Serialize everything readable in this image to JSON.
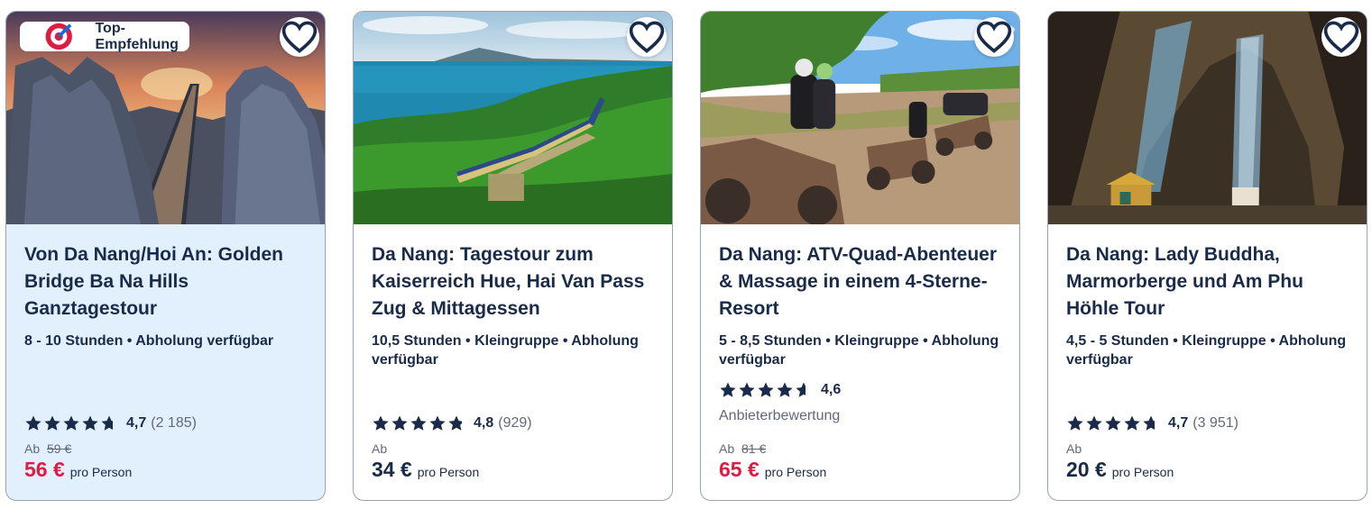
{
  "cards": [
    {
      "badge": "Top-Empfehlung",
      "title": "Von Da Nang/Hoi An: Golden Bridge Ba Na Hills Ganztagestour",
      "meta": "8 - 10 Stunden • Abholung verfügbar",
      "rating": {
        "stars": 4.7,
        "score": "4,7",
        "count": "(2 185)"
      },
      "price": {
        "from_label": "Ab",
        "old": "59 €",
        "amount": "56 €",
        "per": "pro Person",
        "on_sale": true
      },
      "icons": {
        "wishlist": "heart-icon",
        "badge": "target-icon"
      }
    },
    {
      "title": "Da Nang: Tagestour zum Kaiserreich Hue, Hai Van Pass Zug & Mittagessen",
      "meta": "10,5 Stunden • Kleingruppe • Abholung verfügbar",
      "rating": {
        "stars": 4.8,
        "score": "4,8",
        "count": "(929)"
      },
      "price": {
        "from_label": "Ab",
        "amount": "34 €",
        "per": "pro Person",
        "on_sale": false
      },
      "icons": {
        "wishlist": "heart-icon"
      }
    },
    {
      "title": "Da Nang: ATV-Quad-Abenteuer & Massage in einem 4-Sterne-Resort",
      "meta": "5 - 8,5 Stunden • Kleingruppe • Abholung verfügbar",
      "rating": {
        "stars": 4.6,
        "score": "4,6"
      },
      "provider_label": "Anbieterbewertung",
      "price": {
        "from_label": "Ab",
        "old": "81 €",
        "amount": "65 €",
        "per": "pro Person",
        "on_sale": true
      },
      "icons": {
        "wishlist": "heart-icon"
      }
    },
    {
      "title": "Da Nang: Lady Buddha, Marmorberge und Am Phu Höhle Tour",
      "meta": "4,5 - 5 Stunden • Kleingruppe • Abholung verfügbar",
      "rating": {
        "stars": 4.7,
        "score": "4,7",
        "count": "(3 951)"
      },
      "price": {
        "from_label": "Ab",
        "amount": "20 €",
        "per": "pro Person",
        "on_sale": false
      },
      "icons": {
        "wishlist": "heart-icon"
      }
    }
  ],
  "colors": {
    "text": "#1a2b49",
    "sale": "#dc1c42",
    "muted": "#63687a",
    "highlight_bg": "#e2f0fd",
    "star": "#1a2b49"
  }
}
